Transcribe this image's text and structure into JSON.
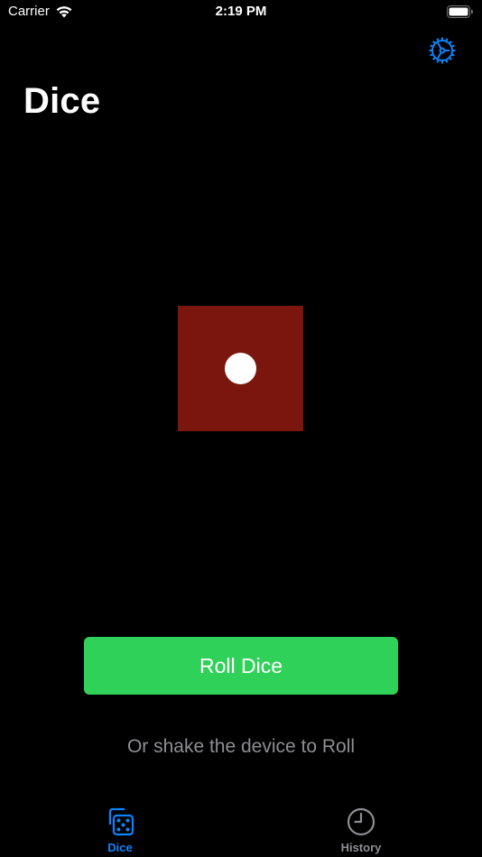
{
  "status_bar": {
    "carrier": "Carrier",
    "time": "2:19 PM",
    "wifi_icon": "wifi-icon",
    "battery_icon": "battery-icon"
  },
  "header": {
    "title": "Dice",
    "settings_icon": "gear-icon"
  },
  "die": {
    "value": 1,
    "color": "#7a160d",
    "pip_color": "#ffffff"
  },
  "roll_button": {
    "label": "Roll Dice",
    "color": "#30d158"
  },
  "hint": "Or shake the device to Roll",
  "tab_bar": {
    "tabs": [
      {
        "label": "Dice",
        "icon": "dice-icon",
        "selected": true,
        "color": "#0a84ff"
      },
      {
        "label": "History",
        "icon": "clock-icon",
        "selected": false,
        "color": "#8e8e93"
      }
    ]
  }
}
